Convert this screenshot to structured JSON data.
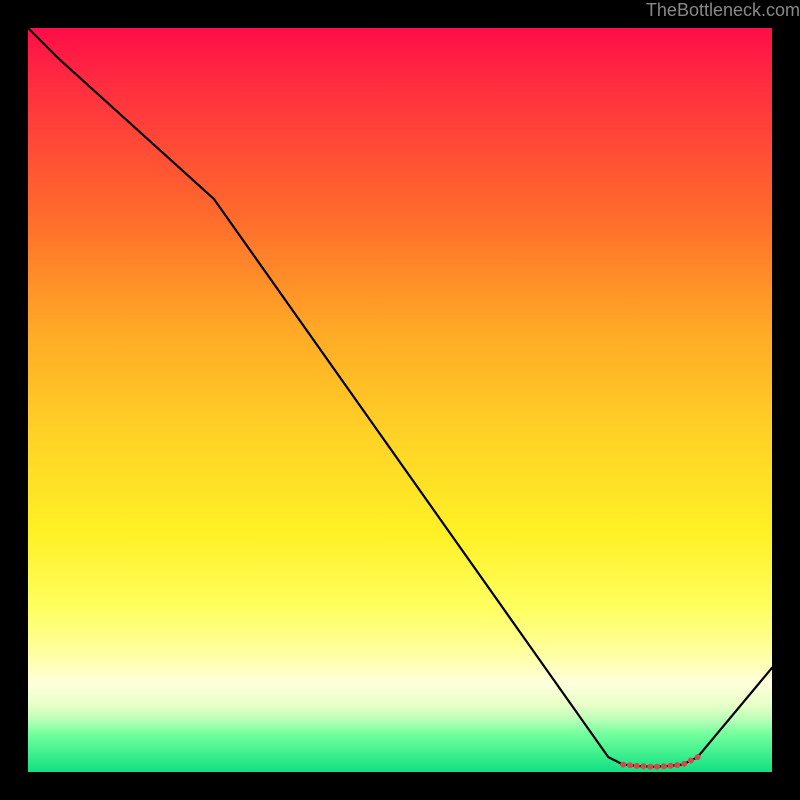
{
  "watermark": "TheBottleneck.com",
  "chart_data": {
    "type": "line",
    "title": "",
    "xlabel": "",
    "ylabel": "",
    "xlim": [
      0,
      100
    ],
    "ylim": [
      0,
      100
    ],
    "series": [
      {
        "name": "bottleneck-curve",
        "x": [
          0,
          4,
          25,
          78,
          80,
          82,
          84,
          86,
          88,
          90,
          100
        ],
        "values": [
          100,
          96,
          77,
          2,
          1,
          0.8,
          0.7,
          0.8,
          1,
          2,
          14
        ]
      }
    ],
    "flat_region": {
      "x_start": 80,
      "x_end": 90
    }
  }
}
